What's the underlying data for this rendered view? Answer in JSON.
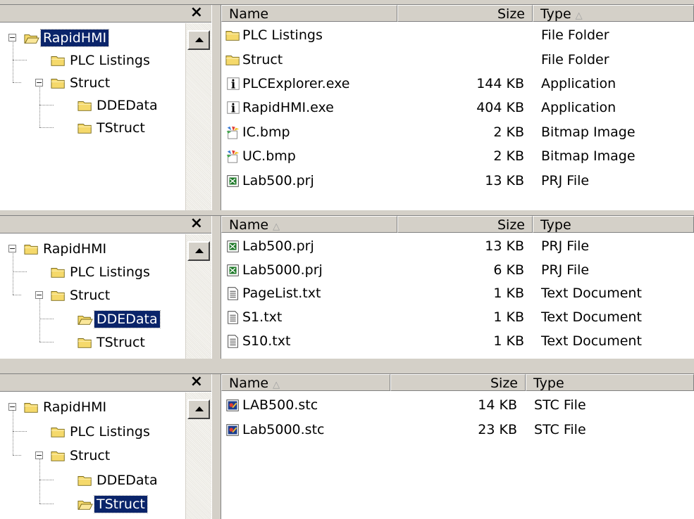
{
  "panels": [
    {
      "columns": {
        "name": "Name",
        "size": "Size",
        "type": "Type",
        "sorted": "type"
      },
      "tree": {
        "selected": "RapidHMI"
      },
      "files": [
        {
          "icon": "folder-icon",
          "name": "PLC Listings",
          "size": "",
          "type": "File Folder"
        },
        {
          "icon": "folder-icon",
          "name": "Struct",
          "size": "",
          "type": "File Folder"
        },
        {
          "icon": "app-icon",
          "name": "PLCExplorer.exe",
          "size": "144 KB",
          "type": "Application"
        },
        {
          "icon": "app-icon",
          "name": "RapidHMI.exe",
          "size": "404 KB",
          "type": "Application"
        },
        {
          "icon": "bitmap-icon",
          "name": "IC.bmp",
          "size": "2 KB",
          "type": "Bitmap Image"
        },
        {
          "icon": "bitmap-icon",
          "name": "UC.bmp",
          "size": "2 KB",
          "type": "Bitmap Image"
        },
        {
          "icon": "prj-icon",
          "name": "Lab500.prj",
          "size": "13 KB",
          "type": "PRJ File"
        }
      ]
    },
    {
      "columns": {
        "name": "Name",
        "size": "Size",
        "type": "Type",
        "sorted": "name"
      },
      "tree": {
        "selected": "DDEData"
      },
      "files": [
        {
          "icon": "prj-icon",
          "name": "Lab500.prj",
          "size": "13 KB",
          "type": "PRJ File"
        },
        {
          "icon": "prj-icon",
          "name": "Lab5000.prj",
          "size": "6 KB",
          "type": "PRJ File"
        },
        {
          "icon": "text-doc-icon",
          "name": "PageList.txt",
          "size": "1 KB",
          "type": "Text Document"
        },
        {
          "icon": "text-doc-icon",
          "name": "S1.txt",
          "size": "1 KB",
          "type": "Text Document"
        },
        {
          "icon": "text-doc-icon",
          "name": "S10.txt",
          "size": "1 KB",
          "type": "Text Document"
        }
      ]
    },
    {
      "columns": {
        "name": "Name",
        "size": "Size",
        "type": "Type",
        "sorted": "name"
      },
      "tree": {
        "selected": "TStruct"
      },
      "files": [
        {
          "icon": "stc-icon",
          "name": "LAB500.stc",
          "size": "14 KB",
          "type": "STC File"
        },
        {
          "icon": "stc-icon",
          "name": "Lab5000.stc",
          "size": "23 KB",
          "type": "STC File"
        }
      ]
    }
  ],
  "tree_nodes": [
    {
      "label": "RapidHMI",
      "expander": "−"
    },
    {
      "label": "PLC Listings"
    },
    {
      "label": "Struct",
      "expander": "−"
    },
    {
      "label": "DDEData"
    },
    {
      "label": "TStruct"
    }
  ],
  "close_label": "×",
  "sort_glyph": "△",
  "colors": {
    "chrome": "#d4d0c8",
    "selection": "#0a246a",
    "folder": "#f5d96b"
  }
}
